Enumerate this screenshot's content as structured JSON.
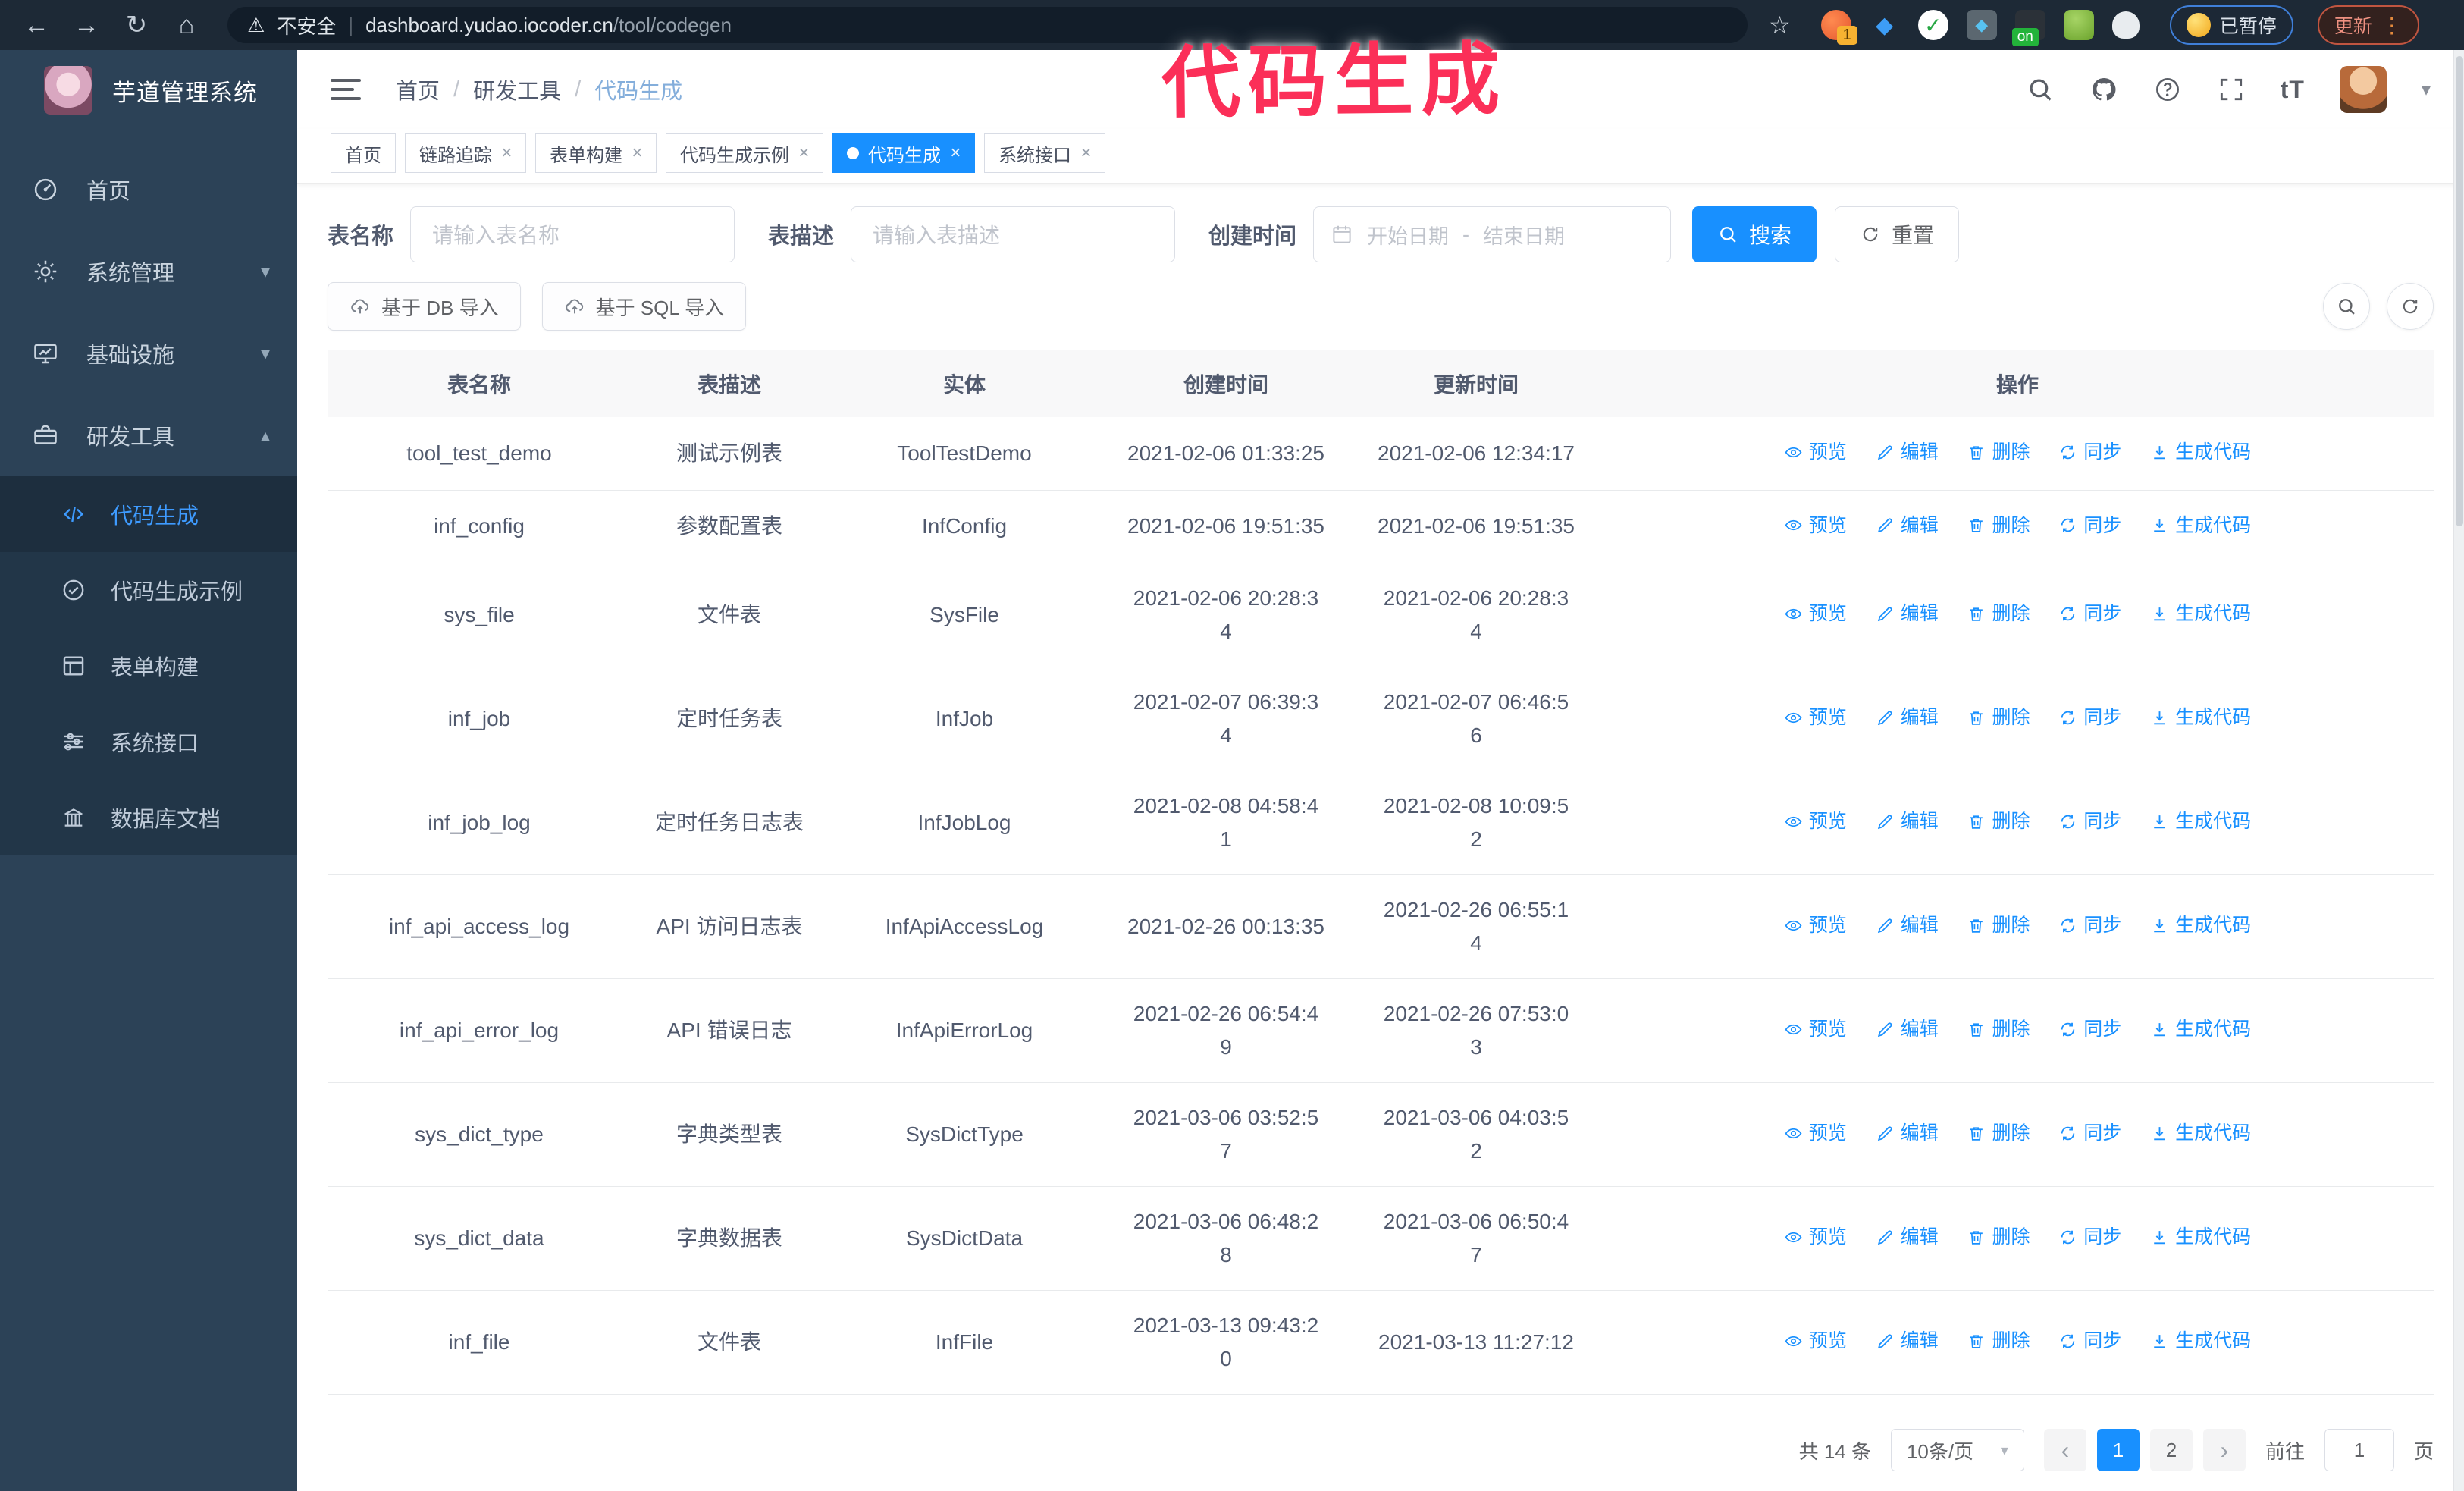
{
  "annotation": {
    "text": "代码生成",
    "color": "#fb2f58"
  },
  "glyphs": {
    "back": "←",
    "forward": "→",
    "reload": "↻",
    "home": "⌂",
    "warning": "⚠",
    "star": "☆",
    "divider": "|",
    "kebab": "⋮",
    "caret_down": "▾",
    "close": "×",
    "prev": "‹",
    "next": "›",
    "breadcrumb_sep": "/",
    "check": "✓",
    "font_size": "tT"
  },
  "browser": {
    "security_label": "不安全",
    "url_domain": "dashboard.yudao.iocoder.cn",
    "url_path": "/tool/codegen",
    "ext_badge_1": "1",
    "ext_badge_on": "on",
    "paused_pill": "已暂停",
    "update_pill": "更新"
  },
  "sidebar": {
    "title": "芋道管理系统",
    "items": [
      {
        "label": "首页",
        "icon": "dashboard-icon",
        "icon_ref": "#i-dashboard",
        "chevron": ""
      },
      {
        "label": "系统管理",
        "icon": "gear-icon",
        "icon_ref": "#i-gear",
        "chevron": "▾"
      },
      {
        "label": "基础设施",
        "icon": "monitor-icon",
        "icon_ref": "#i-monitor",
        "chevron": "▾"
      },
      {
        "label": "研发工具",
        "icon": "toolbox-icon",
        "icon_ref": "#i-toolbox",
        "chevron": "▴"
      }
    ],
    "subitems": [
      {
        "label": "代码生成",
        "icon": "code-icon",
        "icon_ref": "#i-code",
        "active": true
      },
      {
        "label": "代码生成示例",
        "icon": "badge-check-icon",
        "icon_ref": "#i-badge",
        "active": false
      },
      {
        "label": "表单构建",
        "icon": "form-icon",
        "icon_ref": "#i-form",
        "active": false
      },
      {
        "label": "系统接口",
        "icon": "sliders-icon",
        "icon_ref": "#i-sliders",
        "active": false
      },
      {
        "label": "数据库文档",
        "icon": "database-icon",
        "icon_ref": "#i-columns",
        "active": false
      }
    ]
  },
  "navbar": {
    "breadcrumb": [
      "首页",
      "研发工具",
      "代码生成"
    ]
  },
  "tags": [
    {
      "label": "首页",
      "closable": false,
      "active": false
    },
    {
      "label": "链路追踪",
      "closable": true,
      "active": false
    },
    {
      "label": "表单构建",
      "closable": true,
      "active": false
    },
    {
      "label": "代码生成示例",
      "closable": true,
      "active": false
    },
    {
      "label": "代码生成",
      "closable": true,
      "active": true
    },
    {
      "label": "系统接口",
      "closable": true,
      "active": false
    }
  ],
  "filters": {
    "name_label": "表名称",
    "name_placeholder": "请输入表名称",
    "desc_label": "表描述",
    "desc_placeholder": "请输入表描述",
    "time_label": "创建时间",
    "start_placeholder": "开始日期",
    "range_separator": "-",
    "end_placeholder": "结束日期",
    "search_label": "搜索",
    "reset_label": "重置"
  },
  "toolbar": {
    "import_db": "基于 DB 导入",
    "import_sql": "基于 SQL 导入"
  },
  "table": {
    "columns": [
      "表名称",
      "表描述",
      "实体",
      "创建时间",
      "更新时间",
      "操作"
    ],
    "actions": [
      {
        "label": "预览"
      },
      {
        "label": "编辑"
      },
      {
        "label": "删除"
      },
      {
        "label": "同步"
      },
      {
        "label": "生成代码"
      }
    ],
    "rows": [
      {
        "name": "tool_test_demo",
        "desc": "测试示例表",
        "entity": "ToolTestDemo",
        "created": "2021-02-06 01:33:25",
        "updated": "2021-02-06 12:34:17"
      },
      {
        "name": "inf_config",
        "desc": "参数配置表",
        "entity": "InfConfig",
        "created": "2021-02-06 19:51:35",
        "updated": "2021-02-06 19:51:35"
      },
      {
        "name": "sys_file",
        "desc": "文件表",
        "entity": "SysFile",
        "created": "2021-02-06 20:28:3\n4",
        "updated": "2021-02-06 20:28:3\n4"
      },
      {
        "name": "inf_job",
        "desc": "定时任务表",
        "entity": "InfJob",
        "created": "2021-02-07 06:39:3\n4",
        "updated": "2021-02-07 06:46:5\n6"
      },
      {
        "name": "inf_job_log",
        "desc": "定时任务日志表",
        "entity": "InfJobLog",
        "created": "2021-02-08 04:58:4\n1",
        "updated": "2021-02-08 10:09:5\n2"
      },
      {
        "name": "inf_api_access_log",
        "desc": "API 访问日志表",
        "entity": "InfApiAccessLog",
        "created": "2021-02-26 00:13:35",
        "updated": "2021-02-26 06:55:1\n4"
      },
      {
        "name": "inf_api_error_log",
        "desc": "API 错误日志",
        "entity": "InfApiErrorLog",
        "created": "2021-02-26 06:54:4\n9",
        "updated": "2021-02-26 07:53:0\n3"
      },
      {
        "name": "sys_dict_type",
        "desc": "字典类型表",
        "entity": "SysDictType",
        "created": "2021-03-06 03:52:5\n7",
        "updated": "2021-03-06 04:03:5\n2"
      },
      {
        "name": "sys_dict_data",
        "desc": "字典数据表",
        "entity": "SysDictData",
        "created": "2021-03-06 06:48:2\n8",
        "updated": "2021-03-06 06:50:4\n7"
      },
      {
        "name": "inf_file",
        "desc": "文件表",
        "entity": "InfFile",
        "created": "2021-03-13 09:43:2\n0",
        "updated": "2021-03-13 11:27:12"
      }
    ]
  },
  "pagination": {
    "total": "共 14 条",
    "page_size": "10条/页",
    "pages": [
      {
        "label": "1",
        "active": true
      },
      {
        "label": "2",
        "active": false
      }
    ],
    "goto_label": "前往",
    "goto_value": "1",
    "page_label": "页"
  },
  "colors": {
    "primary": "#1890ff",
    "sidebar": "#2c4257",
    "submenu": "#223648",
    "annotation": "#fb2f58"
  }
}
